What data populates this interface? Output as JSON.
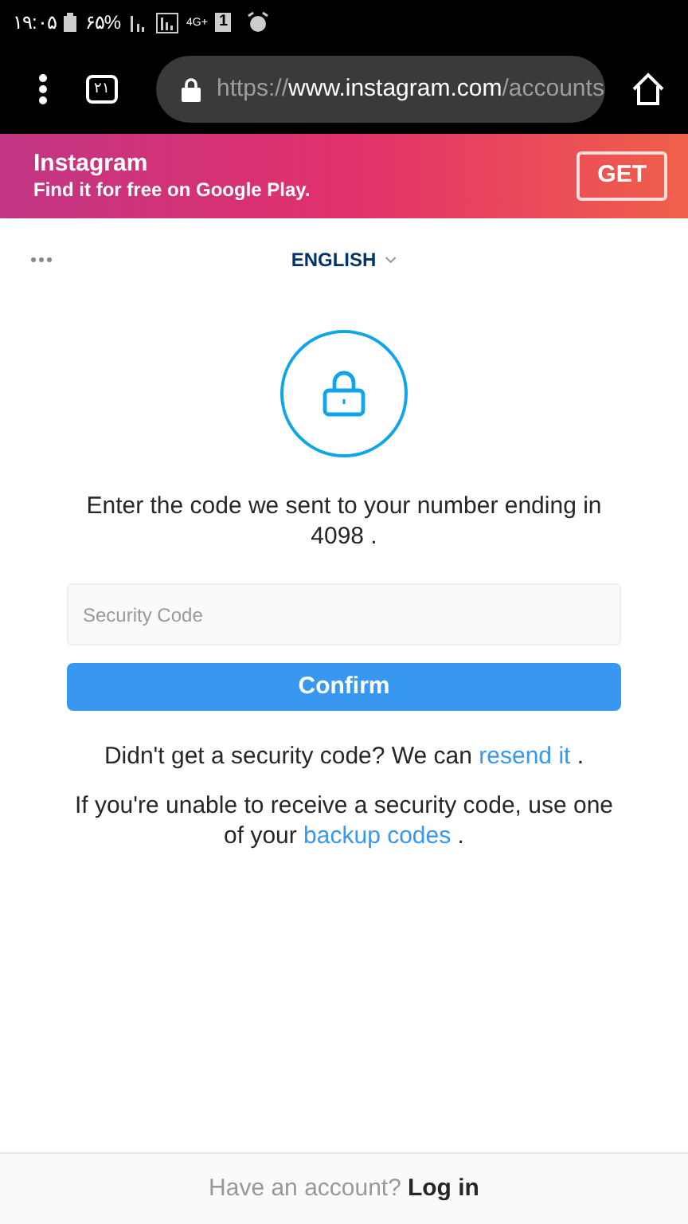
{
  "status_bar": {
    "time": "۱۹:۰۵",
    "battery": "۶۵%",
    "network": "4G+",
    "sim": "1"
  },
  "browser": {
    "tab_count": "۲۱",
    "url": [
      {
        "kind": "dim",
        "text": "https://"
      },
      {
        "kind": "main",
        "text": "www.instagram.com"
      },
      {
        "kind": "dim",
        "text": "/accounts"
      }
    ]
  },
  "banner": {
    "title": "Instagram",
    "subtitle": "Find it for free on Google Play.",
    "button": "GET"
  },
  "language": "ENGLISH",
  "message": "Enter the code we sent to your number ending in 4098 .",
  "field": {
    "placeholder": "Security Code"
  },
  "confirm": "Confirm",
  "resend": [
    {
      "kind": "text",
      "text": "Didn't get a security code? We can "
    },
    {
      "kind": "link",
      "text": "resend it"
    },
    {
      "kind": "text",
      "text": " ."
    }
  ],
  "backup": [
    {
      "kind": "text",
      "text": "If you're unable to receive a security code, use one of your "
    },
    {
      "kind": "link",
      "text": "backup codes"
    },
    {
      "kind": "text",
      "text": " ."
    }
  ],
  "footer": {
    "prompt": "Have an account?",
    "link": "Log in"
  }
}
